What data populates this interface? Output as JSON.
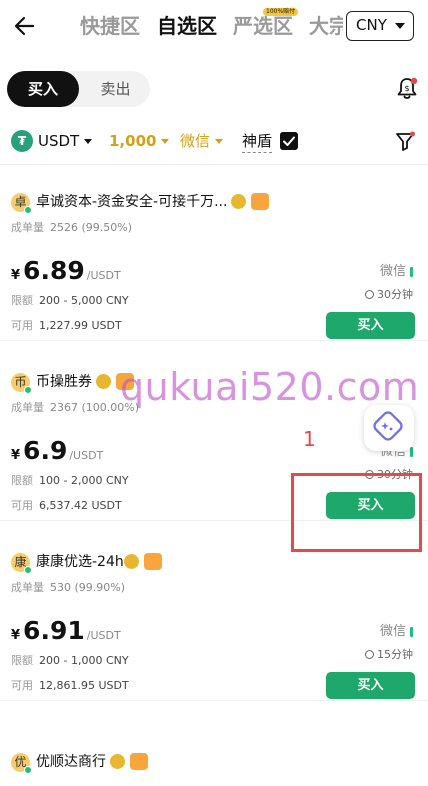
{
  "header": {
    "tabs": [
      {
        "label": "快捷区",
        "active": false
      },
      {
        "label": "自选区",
        "active": true
      },
      {
        "label": "严选区",
        "active": false,
        "badge": "100%赔付"
      },
      {
        "label": "大宗",
        "active": false
      }
    ],
    "currency": "CNY",
    "icons": {
      "back": "arrow-left-icon",
      "currency_caret": "caret-down-icon"
    }
  },
  "trade_toggle": {
    "buy_label": "买入",
    "sell_label": "卖出",
    "selected": "buy"
  },
  "notification_icon": "bell-icon",
  "filters": {
    "coin": "USDT",
    "amount": "1,000",
    "payment": "微信",
    "shield_label": "神盾",
    "shield_checked": true,
    "icons": {
      "coin": "tether-icon",
      "filter": "funnel-icon"
    }
  },
  "listings": [
    {
      "avatar_char": "卓",
      "merchant": "卓诚资本-资金安全-可接千万...",
      "stats_label": "成单量",
      "stats_value": "2526 (99.50%)",
      "currency_symbol": "¥",
      "price": "6.89",
      "price_unit": "/USDT",
      "limit_label": "限额",
      "limit_value": "200 - 5,000 CNY",
      "available_label": "可用",
      "available_value": "1,227.99 USDT",
      "payment": "微信",
      "time": "30分钟",
      "buy_label": "买入"
    },
    {
      "avatar_char": "币",
      "merchant": "币操胜券",
      "stats_label": "成单量",
      "stats_value": "2367 (100.00%)",
      "currency_symbol": "¥",
      "price": "6.9",
      "price_unit": "/USDT",
      "limit_label": "限额",
      "limit_value": "100 - 2,000 CNY",
      "available_label": "可用",
      "available_value": "6,537.42 USDT",
      "payment": "微信",
      "time": "30分钟",
      "buy_label": "买入"
    },
    {
      "avatar_char": "康",
      "merchant": "康康优选-24h",
      "stats_label": "成单量",
      "stats_value": "530 (99.90%)",
      "currency_symbol": "¥",
      "price": "6.91",
      "price_unit": "/USDT",
      "limit_label": "限额",
      "limit_value": "200 - 1,000 CNY",
      "available_label": "可用",
      "available_value": "12,861.95 USDT",
      "payment": "微信",
      "time": "15分钟",
      "buy_label": "买入"
    },
    {
      "avatar_char": "优",
      "merchant": "优顺达商行"
    }
  ],
  "overlays": {
    "watermark": "qukuai520.com",
    "annotation_number": "1",
    "annotation_color": "#e5484d",
    "fab_icon": "ai-assistant-icon"
  },
  "colors": {
    "accent_gold": "#d4a017",
    "buy_green": "#1fa86b",
    "online_green": "#1fbf75"
  }
}
